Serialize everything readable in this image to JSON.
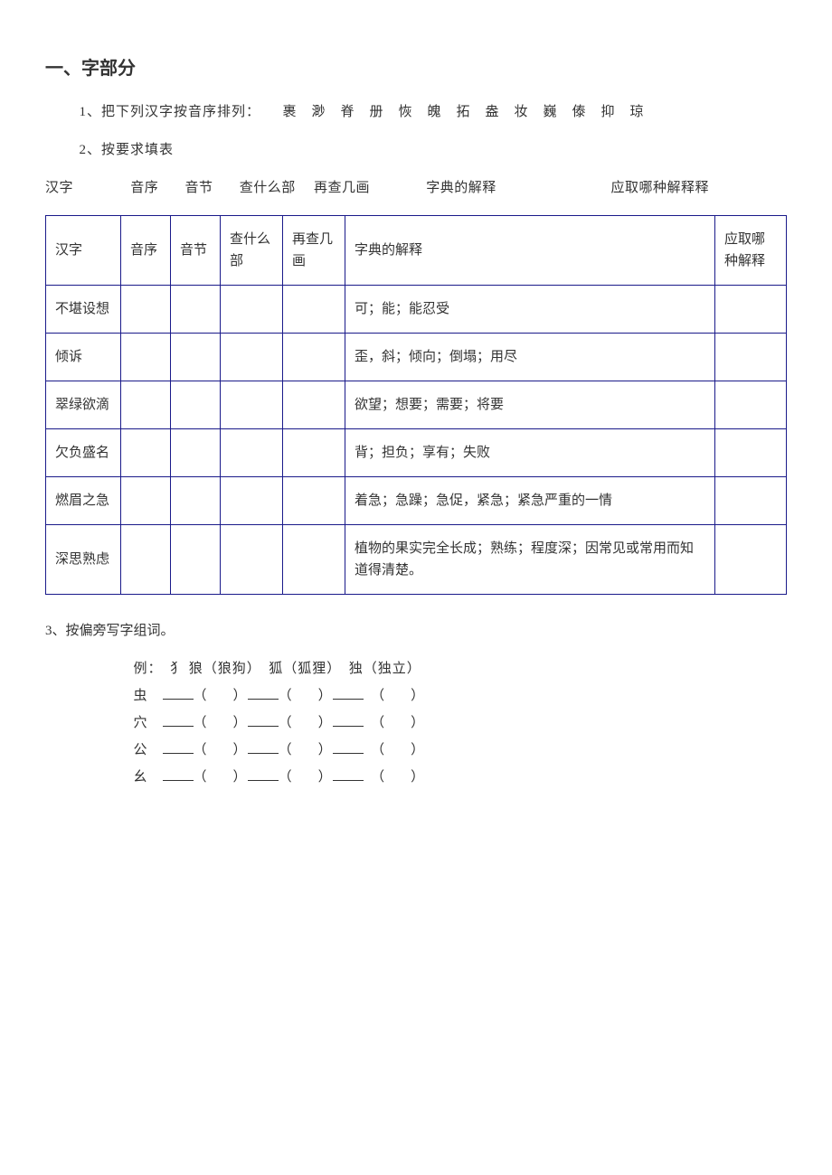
{
  "section": {
    "title": "一、字部分",
    "q1": "1、把下列汉字按音序排列：　　裹　渺　脊　册　恢　魄　拓　盎　妆　巍　傣　抑　琼",
    "q2_intro": "2、按要求填表",
    "label_row": {
      "hanzi": "汉字",
      "yinxu": "音序",
      "yinjie": "音节",
      "bushou": "查什么部",
      "ji_hua": "再查几画",
      "jieshi": "字典的解释",
      "qushi": "应取哪种解释释"
    },
    "table": {
      "headers": {
        "hanzi": "汉字",
        "yinxu": "音序",
        "yinjie": "音节",
        "bushou": "查什么部",
        "ji_hua": "再查几画",
        "jieshi": "字典的解释",
        "qushi": "应取哪种解释"
      },
      "rows": [
        {
          "hanzi": "不堪设想",
          "jieshi": "可；能；能忍受"
        },
        {
          "hanzi": "倾诉",
          "jieshi": "歪，斜；倾向；倒塌；用尽"
        },
        {
          "hanzi": "翠绿欲滴",
          "jieshi": "欲望；想要；需要；将要"
        },
        {
          "hanzi": "欠负盛名",
          "jieshi": "背；担负；享有；失败"
        },
        {
          "hanzi": "燃眉之急",
          "jieshi": "着急；急躁；急促，紧急；紧急严重的一情"
        },
        {
          "hanzi": "深思熟虑",
          "jieshi": "植物的果实完全长成；熟练；程度深；因常见或常用而知道得清楚。"
        }
      ]
    },
    "q3_intro": "3、按偏旁写字组词。",
    "q3_example": "例：　犭 狼（狼狗）　狐（狐狸）　独（独立）",
    "q3_radicals": [
      "虫",
      "穴",
      "公",
      "幺"
    ]
  }
}
